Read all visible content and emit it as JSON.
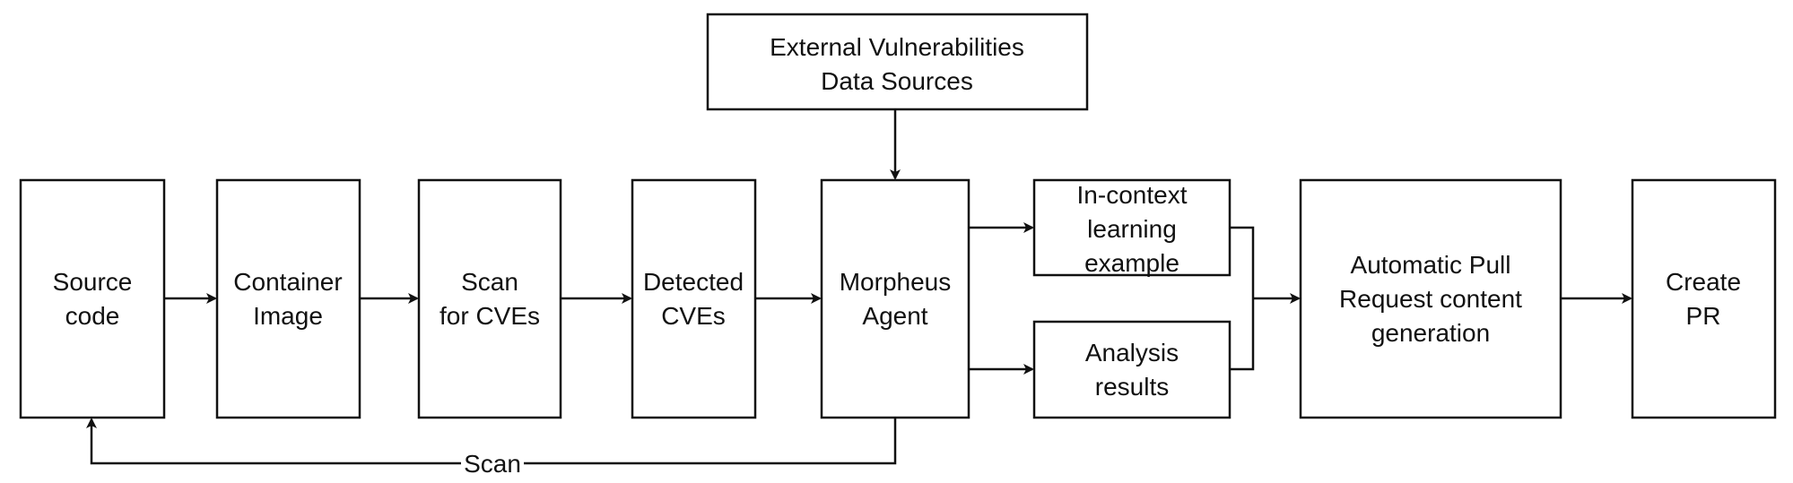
{
  "nodes": {
    "external": {
      "lines": [
        "External Vulnerabilities",
        "Data Sources"
      ]
    },
    "source": {
      "lines": [
        "Source",
        "code"
      ]
    },
    "container": {
      "lines": [
        "Container",
        "Image"
      ]
    },
    "scan": {
      "lines": [
        "Scan",
        "for CVEs"
      ]
    },
    "detected": {
      "lines": [
        "Detected",
        "CVEs"
      ]
    },
    "morpheus": {
      "lines": [
        "Morpheus",
        "Agent"
      ]
    },
    "incontext": {
      "lines": [
        "In-context",
        "learning",
        "example"
      ]
    },
    "analysis": {
      "lines": [
        "Analysis",
        "results"
      ]
    },
    "autopr": {
      "lines": [
        "Automatic Pull",
        "Request content",
        "generation"
      ]
    },
    "createpr": {
      "lines": [
        "Create",
        "PR"
      ]
    }
  },
  "edges": {
    "scan_loop_label": "Scan"
  },
  "colors": {
    "stroke": "#111111",
    "background": "#ffffff"
  }
}
